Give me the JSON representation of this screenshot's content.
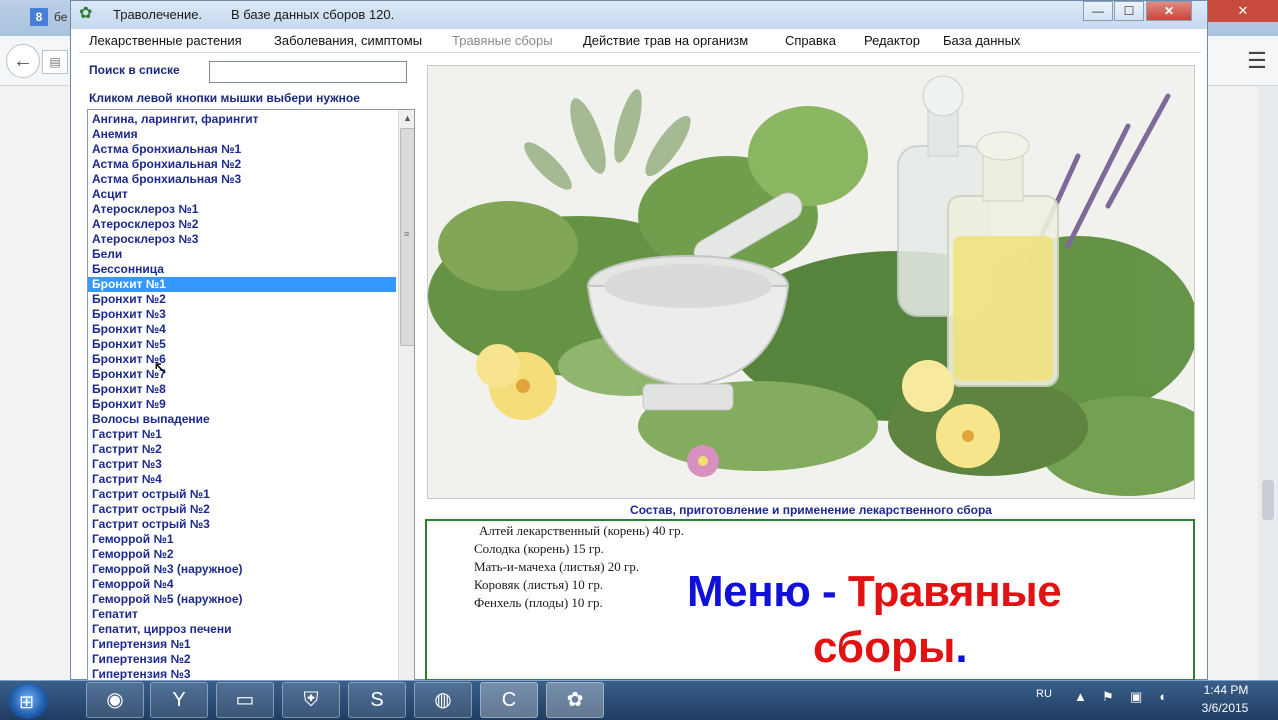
{
  "browser": {
    "tab_title": "бе",
    "google_icon": "8"
  },
  "window": {
    "title": "Траволечение.",
    "db_info": "В базе данных сборов  120.",
    "minimize": "—",
    "maximize": "☐",
    "close": "✕"
  },
  "menu": {
    "items": [
      {
        "label": "Лекарственные растения"
      },
      {
        "label": "Заболевания, симптомы"
      },
      {
        "label": "Травяные сборы"
      },
      {
        "label": "Действие трав на организм"
      },
      {
        "label": "Справка"
      },
      {
        "label": "Редактор"
      },
      {
        "label": "База данных"
      }
    ]
  },
  "search": {
    "label": "Поиск в списке",
    "value": ""
  },
  "hint": "Кликом левой кнопки мышки выбери нужное",
  "list": {
    "selected": "Бронхит №1",
    "items": [
      "Ангина, ларингит, фарингит",
      "Анемия",
      "Астма бронхиальная №1",
      "Астма бронхиальная №2",
      "Астма бронхиальная №3",
      "Асцит",
      "Атеросклероз №1",
      "Атеросклероз №2",
      "Атеросклероз №3",
      "Бели",
      "Бессонница",
      "Бронхит №1",
      "Бронхит №2",
      "Бронхит №3",
      "Бронхит №4",
      "Бронхит №5",
      "Бронхит №6",
      "Бронхит №7",
      "Бронхит №8",
      "Бронхит №9",
      "Волосы выпадение",
      "Гастрит №1",
      "Гастрит №2",
      "Гастрит №3",
      "Гастрит №4",
      "Гастрит острый №1",
      "Гастрит острый №2",
      "Гастрит острый №3",
      "Геморрой №1",
      "Геморрой №2",
      "Геморрой №3 (наружное)",
      "Геморрой №4",
      "Геморрой №5 (наружное)",
      "Гепатит",
      "Гепатит, цирроз печени",
      "Гипертензия №1",
      "Гипертензия №2",
      "Гипертензия №3"
    ]
  },
  "caption": "Состав, приготовление и применение лекарственного сбора",
  "recipe": {
    "ingredients": [
      "Алтей лекарственный (корень)  40 гр.",
      "Солодка (корень)  15 гр.",
      "Мать-и-мачеха (листья)  20 гр.",
      "Коровяк (листья)  10 гр.",
      "Фенхель (плоды)  10 гр."
    ]
  },
  "overlay": {
    "part1": "Меню - ",
    "part2": "Травяные",
    "part3": "сборы",
    "part4": "."
  },
  "taskbar": {
    "language": "RU",
    "time": "1:44 PM",
    "date": "3/6/2015",
    "apps": [
      "chrome-icon",
      "yandex-icon",
      "folder-icon",
      "world-of-tanks-icon",
      "skype-icon",
      "firefox-icon",
      "camtasia-icon",
      "herbal-app-icon"
    ]
  },
  "colors": {
    "list_text": "#1b2a8c",
    "selection": "#3399ff",
    "overlay_blue": "#1010d8",
    "overlay_red": "#e01212",
    "recipe_border": "#2e7d32"
  }
}
